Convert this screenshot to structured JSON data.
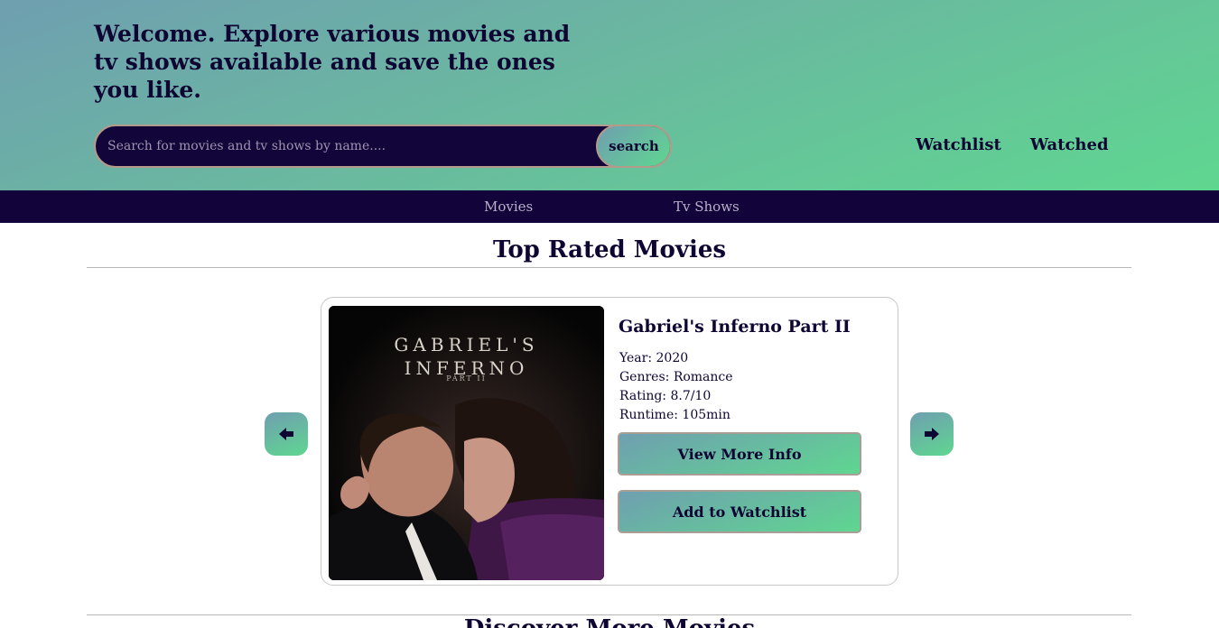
{
  "header": {
    "welcome": "Welcome. Explore various movies and tv shows available and save the ones you like.",
    "search_placeholder": "Search for movies and tv shows by name....",
    "search_button": "search",
    "links": [
      "Watchlist",
      "Watched"
    ]
  },
  "nav": {
    "items": [
      "Movies",
      "Tv Shows"
    ]
  },
  "main": {
    "section_title": "Top Rated Movies",
    "next_section_title": "Discover More Movies",
    "carousel": {
      "poster": {
        "title_line1": "GABRIEL'S",
        "title_line2": "INFERNO",
        "subtitle": "PART II"
      },
      "movie": {
        "title": "Gabriel's Inferno Part II",
        "year": "Year: 2020",
        "genres": "Genres: Romance",
        "rating": "Rating: 8.7/10",
        "runtime": "Runtime: 105min"
      },
      "buttons": {
        "more_info": "View More Info",
        "add_watchlist": "Add to Watchlist"
      },
      "prev_icon": "arrow-left-icon",
      "next_icon": "arrow-right-icon"
    }
  },
  "colors": {
    "primary_dark": "#12033a",
    "gradient_start": "#6f9fb0",
    "gradient_end": "#5fd690",
    "text": "#0f0533"
  }
}
